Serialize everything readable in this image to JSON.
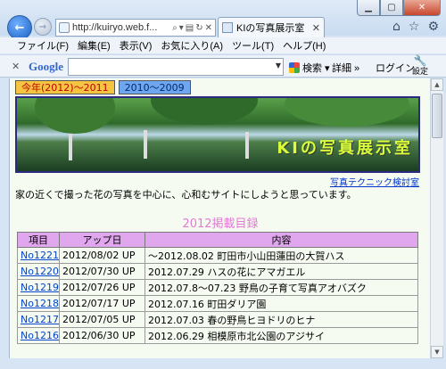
{
  "browser": {
    "address_url": "http://kuiryo.web.f...",
    "tab_title": "KIの写真展示室",
    "menu": [
      "ファイル(F)",
      "編集(E)",
      "表示(V)",
      "お気に入り(A)",
      "ツール(T)",
      "ヘルプ(H)"
    ],
    "google_toolbar": {
      "logo": "Google",
      "search_label": "検索",
      "more_label": "詳細 »",
      "login_label": "ログイン",
      "settings_label": "設定"
    }
  },
  "page": {
    "tabs": [
      "今年(2012)〜2011",
      "2010〜2009"
    ],
    "banner_title": "KIの写真展示室",
    "tech_link": "写真テクニック検討室",
    "intro": "家の近くで撮った花の写真を中心に、心和むサイトにしようと思っています。",
    "list_title": "2012掲載目録",
    "table": {
      "headers": [
        "項目",
        "アップ日",
        "内容"
      ],
      "rows": [
        [
          "No1221",
          "2012/08/02 UP",
          "〜2012.08.02 町田市小山田蓮田の大賀ハス"
        ],
        [
          "No1220",
          "2012/07/30 UP",
          "2012.07.29 ハスの花にアマガエル"
        ],
        [
          "No1219",
          "2012/07/26 UP",
          "2012.07.8〜07.23 野鳥の子育て写真アオバズク"
        ],
        [
          "No1218",
          "2012/07/17 UP",
          "2012.07.16 町田ダリア園"
        ],
        [
          "No1217",
          "2012/07/05 UP",
          "2012.07.03 春の野鳥ヒヨドリのヒナ"
        ],
        [
          "No1216",
          "2012/06/30 UP",
          "2012.06.29 相模原市北公園のアジサイ"
        ]
      ]
    }
  }
}
